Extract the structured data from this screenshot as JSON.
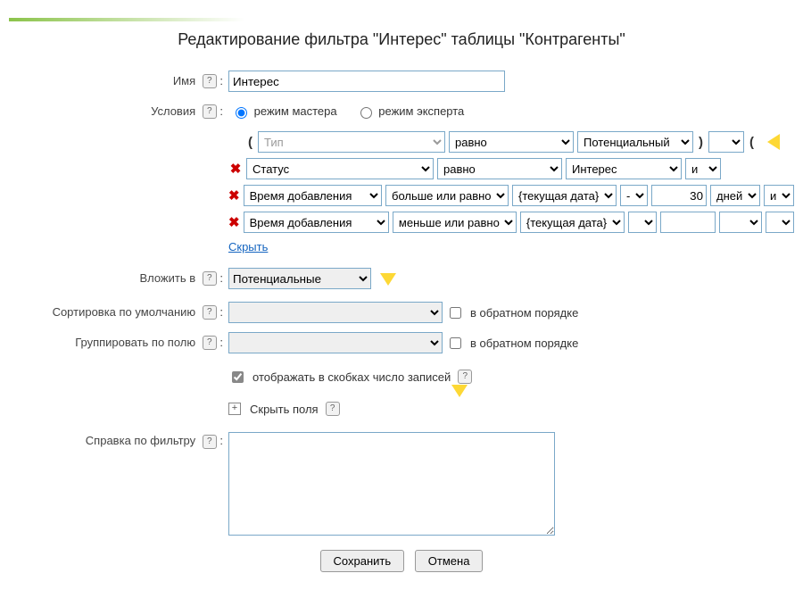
{
  "page_title": "Редактирование фильтра \"Интерес\" таблицы \"Контрагенты\"",
  "labels": {
    "name": "Имя",
    "conditions": "Условия",
    "mode_master": "режим мастера",
    "mode_expert": "режим эксперта",
    "hide_link": "Скрыть",
    "nest_in": "Вложить в",
    "default_sort": "Сортировка по умолчанию",
    "group_by": "Группировать по полю",
    "reverse_order": "в обратном порядке",
    "show_count": "отображать в скобках число записей",
    "hide_fields": "Скрыть поля",
    "filter_help": "Справка по фильтру",
    "save": "Сохранить",
    "cancel": "Отмена"
  },
  "name_value": "Интерес",
  "mode_selected": "master",
  "conditions": [
    {
      "deletable": false,
      "open_paren": true,
      "field_placeholder": "Тип",
      "field": "",
      "op": "равно",
      "value": "Потенциальный",
      "close_paren": true,
      "logic": "",
      "extra_paren": true,
      "arrow": true
    },
    {
      "deletable": true,
      "field": "Статус",
      "op": "равно",
      "value": "Интерес",
      "logic": "и"
    },
    {
      "deletable": true,
      "field": "Время добавления",
      "op": "больше или равно",
      "value": "{текущая дата}",
      "offset_sign": "-",
      "offset_value": "30",
      "offset_unit": "дней",
      "logic": "и"
    },
    {
      "deletable": true,
      "field": "Время добавления",
      "op": "меньше или равно",
      "value": "{текущая дата}",
      "offset_sign": "",
      "offset_value": "",
      "offset_unit": "",
      "logic": ""
    }
  ],
  "nest_in_value": "Потенциальные",
  "default_sort_value": "",
  "group_by_value": "",
  "reverse_sort_checked": false,
  "reverse_group_checked": false,
  "show_count_checked": true,
  "filter_help_text": ""
}
